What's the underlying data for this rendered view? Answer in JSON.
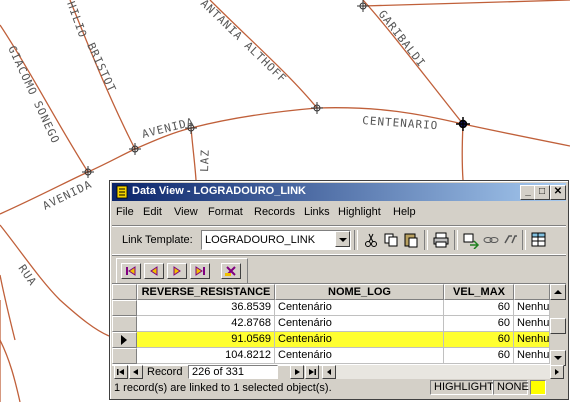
{
  "map": {
    "labels": {
      "avenida_upper": "AVENIDA",
      "avenida_lower": "AVENIDA",
      "centenario": "CENTENARIO",
      "laz": "LAZ",
      "rua": "RUA",
      "giacomo": "GIACOMO SONEGO",
      "bristot": "BRISTOT",
      "hilio": "HILIO",
      "antonia": "ANTANIA ALTHOFF",
      "garibaldi": "GARIBALDI"
    },
    "road_color": "#c0603a"
  },
  "window": {
    "title": "Data View - LOGRADOURO_LINK",
    "minimize": "_",
    "maximize": "□",
    "close": "✕"
  },
  "menu": [
    "File",
    "Edit",
    "View",
    "Format",
    "Records",
    "Links",
    "Highlight",
    "Help"
  ],
  "toolbar": {
    "link_template_label": "Link Template:",
    "link_template_value": "LOGRADOURO_LINK",
    "icons": [
      "cut-icon",
      "copy-icon",
      "paste-icon",
      "print-icon",
      "link-records-icon",
      "link-icon",
      "unlink-icon",
      "table-icon"
    ]
  },
  "nav_buttons": [
    "first-record-icon",
    "previous-record-icon",
    "next-record-icon",
    "last-record-icon",
    "clear-icon"
  ],
  "table": {
    "columns": [
      "REVERSE_RESISTANCE",
      "NOME_LOG",
      "VEL_MAX",
      "Nenhum"
    ],
    "rows": [
      {
        "reverse_resistance": "36.8539",
        "nome_log": "Centenário",
        "vel_max": "60",
        "extra": "Nenhum",
        "selected": false
      },
      {
        "reverse_resistance": "42.8768",
        "nome_log": "Centenário",
        "vel_max": "60",
        "extra": "Nenhum",
        "selected": false
      },
      {
        "reverse_resistance": "91.0569",
        "nome_log": "Centenário",
        "vel_max": "60",
        "extra": "Nenhum",
        "selected": true
      },
      {
        "reverse_resistance": "104.8212",
        "nome_log": "Centenário",
        "vel_max": "60",
        "extra": "Nenhum",
        "selected": false
      }
    ],
    "selected_color": "#ffff30"
  },
  "record_bar": {
    "label": "Record",
    "position": "226 of 331"
  },
  "status": {
    "message": "1 record(s) are linked to 1 selected object(s).",
    "highlight_label": "HIGHLIGHT",
    "highlight_value": "NONE",
    "highlight_color": "#ffff00"
  }
}
